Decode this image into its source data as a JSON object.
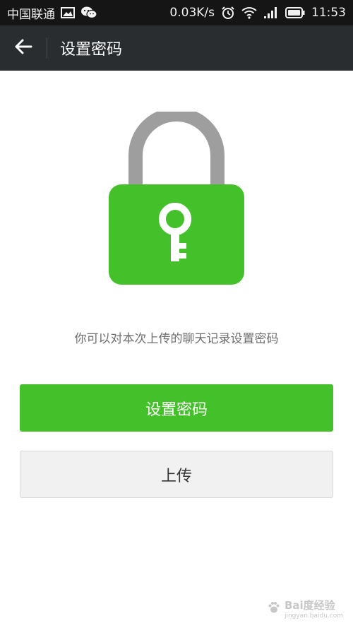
{
  "status_bar": {
    "carrier": "中国联通",
    "network_speed": "0.03K/s",
    "time": "11:53",
    "icons": [
      "gallery-icon",
      "wechat-icon",
      "alarm-icon",
      "wifi-icon",
      "signal-icon",
      "battery-icon"
    ]
  },
  "header": {
    "title": "设置密码",
    "back_icon": "back-arrow-icon"
  },
  "main": {
    "illustration": "lock-with-key-icon",
    "description": "你可以对本次上传的聊天记录设置密码",
    "set_password_button": "设置密码",
    "upload_button": "上传"
  },
  "watermark": {
    "text": "Bai度经验",
    "url": "jingyan.baidu.com"
  },
  "colors": {
    "accent_green": "#44c02a",
    "lock_shackle": "#9e9e9e",
    "header_bg": "#2a2d30",
    "status_bg": "#151515"
  }
}
